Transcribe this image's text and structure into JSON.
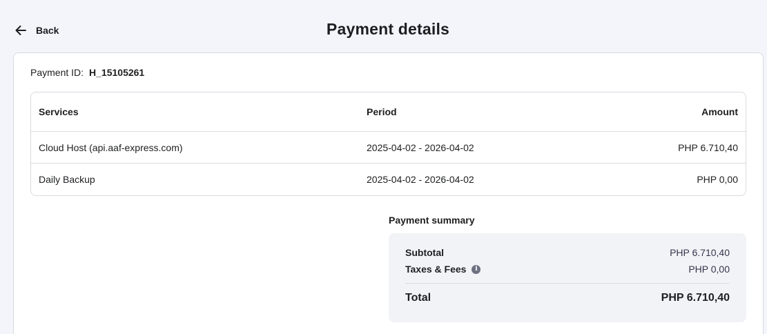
{
  "header": {
    "back_label": "Back",
    "title": "Payment details"
  },
  "payment": {
    "id_label": "Payment ID:",
    "id_value": "H_15105261"
  },
  "table": {
    "columns": {
      "services": "Services",
      "period": "Period",
      "amount": "Amount"
    },
    "rows": [
      {
        "service": "Cloud Host (api.aaf-express.com)",
        "period": "2025-04-02 - 2026-04-02",
        "amount": "PHP 6.710,40"
      },
      {
        "service": "Daily Backup",
        "period": "2025-04-02 - 2026-04-02",
        "amount": "PHP 0,00"
      }
    ]
  },
  "summary": {
    "title": "Payment summary",
    "subtotal_label": "Subtotal",
    "subtotal_value": "PHP 6.710,40",
    "taxes_label": "Taxes & Fees",
    "taxes_value": "PHP 0,00",
    "total_label": "Total",
    "total_value": "PHP 6.710,40"
  },
  "icons": {
    "back": "arrow-left-icon",
    "info": "info-icon"
  },
  "colors": {
    "page_bg": "#f4f5fb",
    "card_bg": "#ffffff",
    "summary_bg": "#f2f3f6",
    "text": "#1d1e20"
  }
}
